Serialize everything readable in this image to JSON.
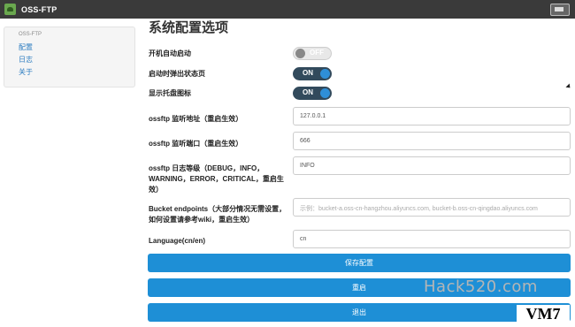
{
  "window": {
    "title": "OSS-FTP",
    "app_icon": "cloud-icon"
  },
  "sidebar": {
    "brand": "OSS-FTP",
    "items": [
      {
        "label": "配置"
      },
      {
        "label": "日志"
      },
      {
        "label": "关于"
      }
    ]
  },
  "main": {
    "title": "系统配置选项",
    "toggles": [
      {
        "label": "开机自动启动",
        "state": "OFF"
      },
      {
        "label": "启动时弹出状态页",
        "state": "ON"
      },
      {
        "label": "显示托盘图标",
        "state": "ON"
      }
    ],
    "fields": [
      {
        "label": "ossftp 监听地址（重启生效）",
        "value": "127.0.0.1"
      },
      {
        "label": "ossftp 监听端口（重启生效）",
        "value": "666"
      },
      {
        "label": "ossftp 日志等级（DEBUG，INFO，WARNING，ERROR，CRITICAL，重启生效）",
        "value": "INFO"
      },
      {
        "label": "Bucket endpoints（大部分情况无需设置，如何设置请参考wiki，重启生效）",
        "placeholder": "示例：bucket-a.oss-cn-hangzhou.aliyuncs.com, bucket-b.oss-cn-qingdao.aliyuncs.com"
      },
      {
        "label": "Language(cn/en)",
        "value": "cn"
      }
    ],
    "buttons": {
      "save": "保存配置",
      "restart": "重启",
      "exit": "退出"
    }
  },
  "overlay": {
    "watermark": "Hack520.com",
    "badge": "VM7"
  },
  "colors": {
    "titlebar": "#3a3a3a",
    "link": "#2a7bc0",
    "toggle_on_bg": "#324a5c",
    "toggle_knob": "#2e8fd8",
    "button": "#1e8fd6"
  }
}
